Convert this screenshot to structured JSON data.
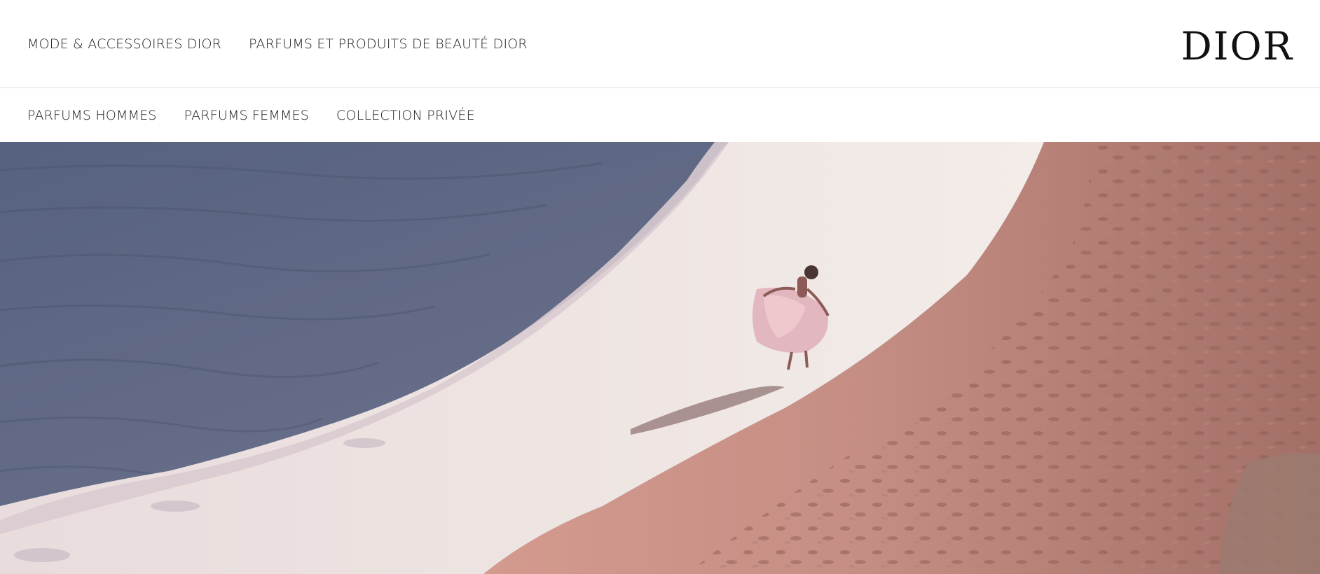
{
  "header": {
    "logo_text": "DIOR",
    "top_nav": [
      {
        "label": "MODE & ACCESSOIRES DIOR"
      },
      {
        "label": "PARFUMS ET PRODUITS DE BEAUTÉ DIOR"
      }
    ]
  },
  "sub_nav": [
    {
      "label": "PARFUMS HOMMES"
    },
    {
      "label": "PARFUMS FEMMES"
    },
    {
      "label": "COLLECTION PRIVÉE"
    }
  ],
  "hero": {
    "colors": {
      "ocean": "#5d6a88",
      "foam": "#efe6e4",
      "wet_sand": "#c98f86",
      "dry_sand": "#a8756b",
      "dress": "#e3b7bf"
    }
  }
}
